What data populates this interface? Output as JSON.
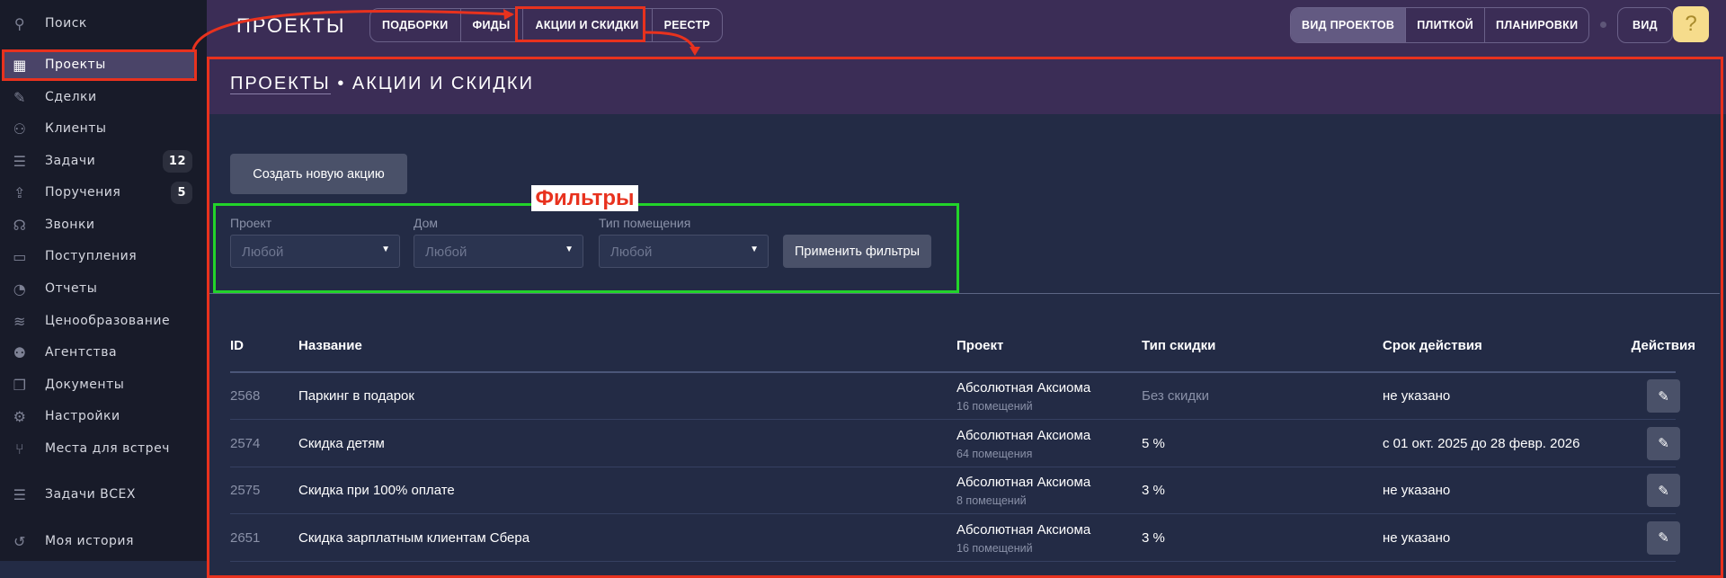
{
  "sidebar": {
    "items": [
      {
        "label": "Поиск",
        "icon": "search-icon"
      },
      {
        "label": "Проекты",
        "icon": "building-icon",
        "active": true
      },
      {
        "label": "Сделки",
        "icon": "deal-icon"
      },
      {
        "label": "Клиенты",
        "icon": "users-icon"
      },
      {
        "label": "Задачи",
        "icon": "task-list-icon",
        "badge": "12"
      },
      {
        "label": "Поручения",
        "icon": "upload-tray-icon",
        "badge": "5"
      },
      {
        "label": "Звонки",
        "icon": "headset-icon"
      },
      {
        "label": "Поступления",
        "icon": "wallet-icon"
      },
      {
        "label": "Отчеты",
        "icon": "pie-chart-icon"
      },
      {
        "label": "Ценообразование",
        "icon": "coins-icon"
      },
      {
        "label": "Агентства",
        "icon": "agent-icon"
      },
      {
        "label": "Документы",
        "icon": "documents-icon"
      },
      {
        "label": "Настройки",
        "icon": "gear-icon"
      },
      {
        "label": "Места для встреч",
        "icon": "meeting-chair-icon"
      },
      {
        "label": "Задачи ВСЕХ",
        "icon": "task-list-icon"
      },
      {
        "label": "Моя история",
        "icon": "history-icon"
      }
    ]
  },
  "topbar": {
    "title": "ПРОЕКТЫ",
    "tabs": [
      "ПОДБОРКИ",
      "ФИДЫ",
      "АКЦИИ И СКИДКИ",
      "РЕЕСТР"
    ],
    "view_modes": [
      "ВИД ПРОЕКТОВ",
      "ПЛИТКОЙ",
      "ПЛАНИРОВКИ"
    ],
    "view_label": "ВИД",
    "help": "?"
  },
  "breadcrumb": {
    "parent": "ПРОЕКТЫ",
    "separator": "•",
    "current": "АКЦИИ И СКИДКИ"
  },
  "create_button": "Создать новую акцию",
  "annotation": {
    "filters_label": "Фильтры",
    "highlight_color": "#e8321e",
    "filters_box_color": "#22d42a"
  },
  "filters": {
    "fields": [
      {
        "label": "Проект",
        "value": "Любой"
      },
      {
        "label": "Дом",
        "value": "Любой"
      },
      {
        "label": "Тип помещения",
        "value": "Любой"
      }
    ],
    "apply": "Применить фильтры"
  },
  "table": {
    "headers": [
      "ID",
      "Название",
      "Проект",
      "Тип скидки",
      "Срок действия",
      "Действия"
    ],
    "rows": [
      {
        "id": "2568",
        "name": "Паркинг в подарок",
        "project": "Абсолютная Аксиома",
        "units": "16 помещений",
        "type": "Без скидки",
        "period": "не указано"
      },
      {
        "id": "2574",
        "name": "Скидка детям",
        "project": "Абсолютная Аксиома",
        "units": "64 помещения",
        "type": "5 %",
        "period": "с 01 окт. 2025 до 28 февр. 2026"
      },
      {
        "id": "2575",
        "name": "Скидка при 100% оплате",
        "project": "Абсолютная Аксиома",
        "units": "8 помещений",
        "type": "3 %",
        "period": "не указано"
      },
      {
        "id": "2651",
        "name": "Скидка зарплатным клиентам Сбера",
        "project": "Абсолютная Аксиома",
        "units": "16 помещений",
        "type": "3 %",
        "period": "не указано"
      }
    ]
  }
}
